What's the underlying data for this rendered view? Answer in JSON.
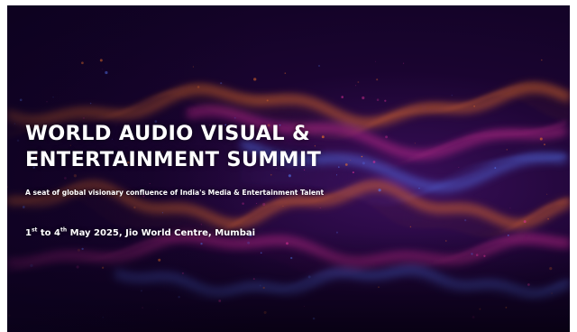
{
  "banner": {
    "title_line1": "WORLD AUDIO VISUAL &",
    "title_line2": "ENTERTAINMENT SUMMIT",
    "tagline": "A seat of global visionary confluence of India's Media & Entertainment Talent",
    "dates": {
      "start_day": "1",
      "start_suffix": "st",
      "connector": " to ",
      "end_day": "4",
      "end_suffix": "th",
      "rest": " May 2025, Jio World Centre, Mumbai"
    },
    "colors": {
      "background": "#1a0430",
      "wave_orange": "#ff7a2a",
      "wave_magenta": "#e0309a",
      "wave_blue": "#5a7cff",
      "text": "#ffffff"
    }
  }
}
